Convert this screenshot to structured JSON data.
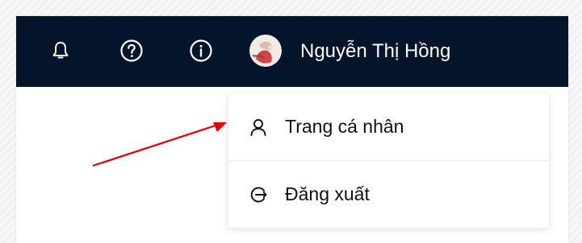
{
  "header": {
    "user_name": "Nguyễn Thị Hồng",
    "icons": [
      "bell-icon",
      "help-circle-icon",
      "info-circle-icon"
    ],
    "background": "#04152b"
  },
  "user_menu": {
    "items": [
      {
        "label": "Trang cá nhân",
        "icon": "user-icon"
      },
      {
        "label": "Đăng xuất",
        "icon": "logout-icon"
      }
    ]
  },
  "annotation": {
    "arrow_color": "#e60000"
  }
}
